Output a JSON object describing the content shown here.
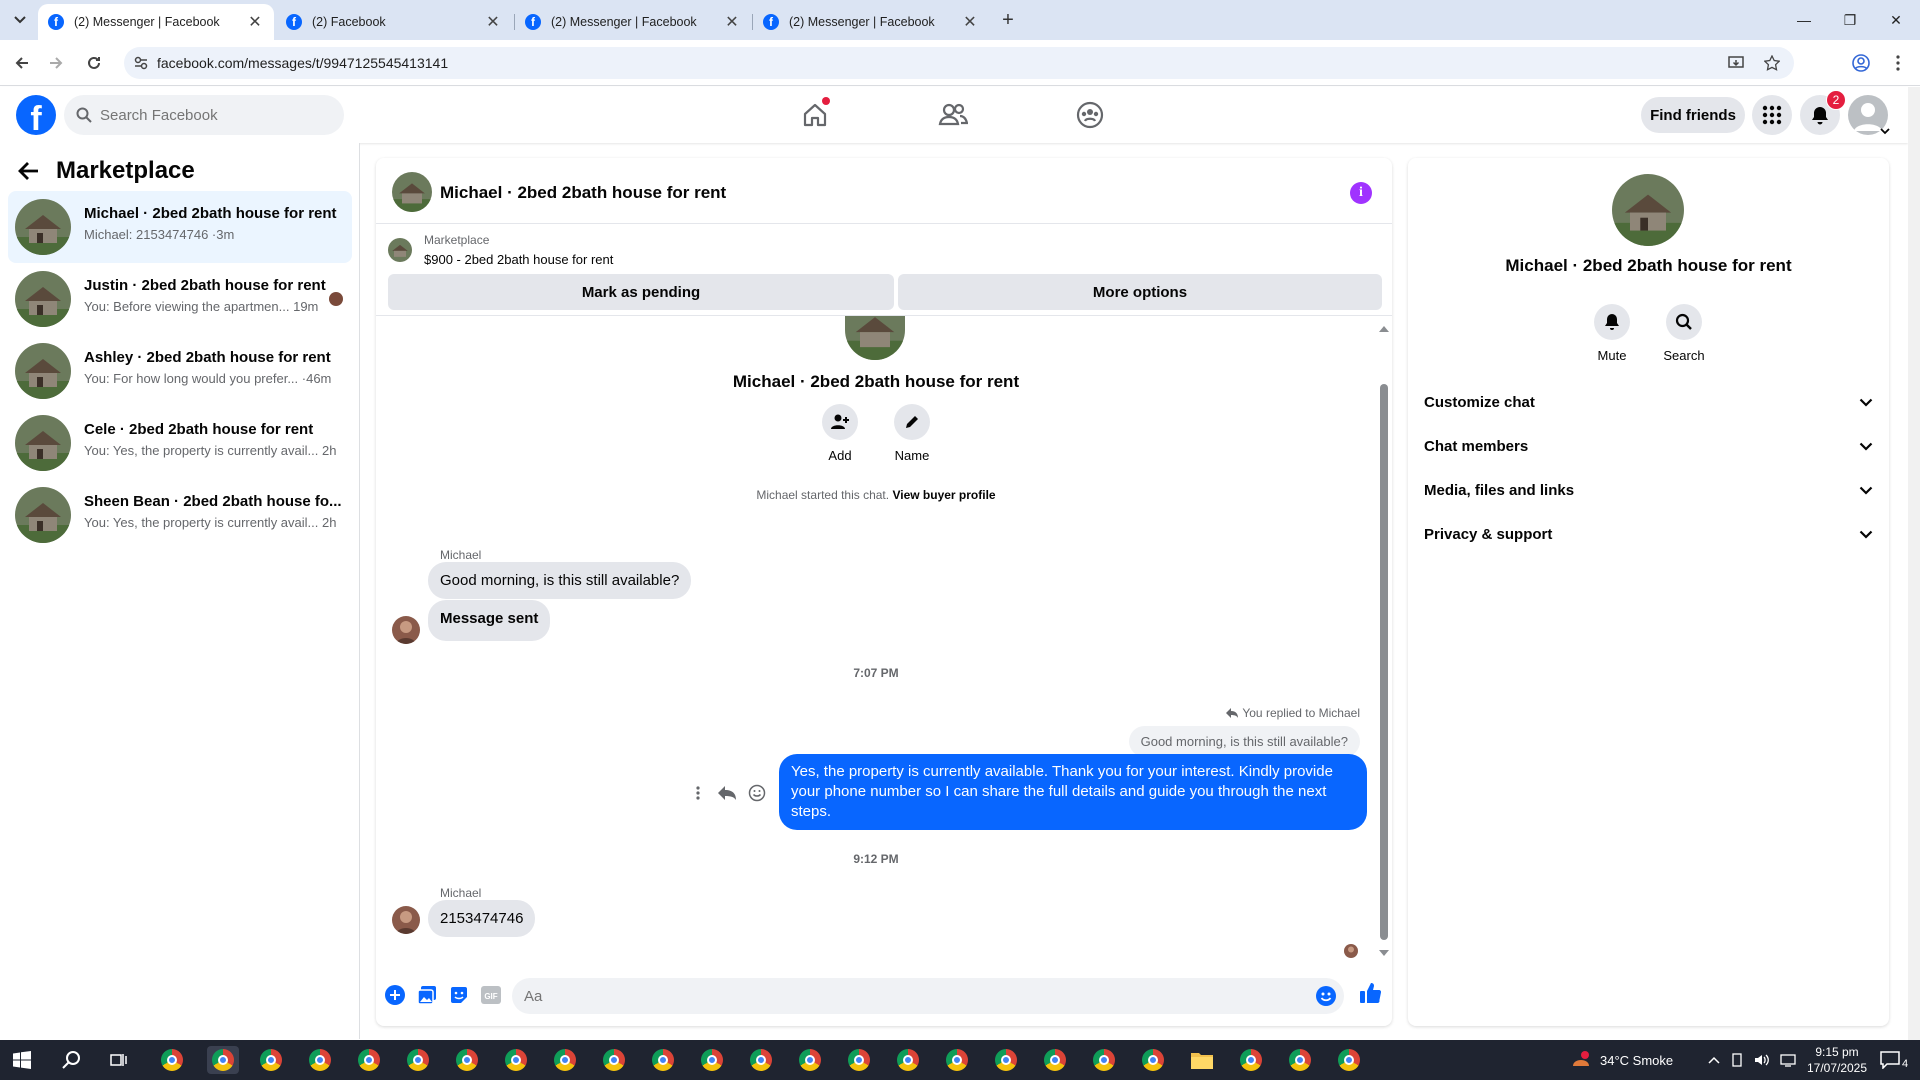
{
  "browser": {
    "tabs": [
      {
        "title": "(2) Messenger | Facebook",
        "active": true
      },
      {
        "title": "(2) Facebook",
        "active": false
      },
      {
        "title": "(2) Messenger | Facebook",
        "active": false
      },
      {
        "title": "(2) Messenger | Facebook",
        "active": false
      }
    ],
    "url": "facebook.com/messages/t/9947125545413141"
  },
  "header": {
    "search_placeholder": "Search Facebook",
    "find_friends": "Find friends",
    "notification_count": "2"
  },
  "left_panel": {
    "title": "Marketplace",
    "conversations": [
      {
        "name": "Michael · 2bed 2bath house for rent",
        "preview": "Michael: 2153474746 ·3m",
        "active": true
      },
      {
        "name": "Justin · 2bed 2bath house for rent",
        "preview": "You: Before viewing the apartmen... 19m",
        "active": false
      },
      {
        "name": "Ashley · 2bed 2bath house for rent",
        "preview": "You: For how long would you prefer... ·46m",
        "active": false
      },
      {
        "name": "Cele · 2bed 2bath house for rent",
        "preview": "You: Yes, the property is currently avail... 2h",
        "active": false
      },
      {
        "name": "Sheen Bean · 2bed 2bath house fo...",
        "preview": "You: Yes, the property is currently avail... 2h",
        "active": false
      }
    ]
  },
  "chat": {
    "title": "Michael · 2bed 2bath house for rent",
    "marketplace_label": "Marketplace",
    "listing": "$900 - 2bed 2bath house for rent",
    "mark_pending": "Mark as pending",
    "more_options": "More options",
    "center_name": "Michael · 2bed 2bath house for rent",
    "add_label": "Add",
    "name_label": "Name",
    "system_text": "Michael started this chat.",
    "view_profile": "View buyer profile",
    "sender1": "Michael",
    "msg1": "Good morning, is this still available?",
    "msg2": "Message sent",
    "time1": "7:07 PM",
    "replied_to": "You replied to Michael",
    "quoted": "Good morning, is this still available?",
    "my_reply": "Yes, the property is currently available. Thank you for your interest. Kindly provide your phone number so I can share the full details and guide you through the next steps.",
    "time2": "9:12 PM",
    "sender2": "Michael",
    "msg3": "2153474746",
    "composer_placeholder": "Aa"
  },
  "right_panel": {
    "name": "Michael · 2bed 2bath house for rent",
    "mute": "Mute",
    "search": "Search",
    "sections": [
      "Customize chat",
      "Chat members",
      "Media, files and links",
      "Privacy & support"
    ]
  },
  "taskbar": {
    "weather": "34°C  Smoke",
    "time": "9:15 pm",
    "date": "17/07/2025",
    "notif_count": "4"
  },
  "colors": {
    "fb_blue": "#0866ff",
    "bubble_grey": "#e4e6eb",
    "active_conv": "#ebf5ff"
  }
}
